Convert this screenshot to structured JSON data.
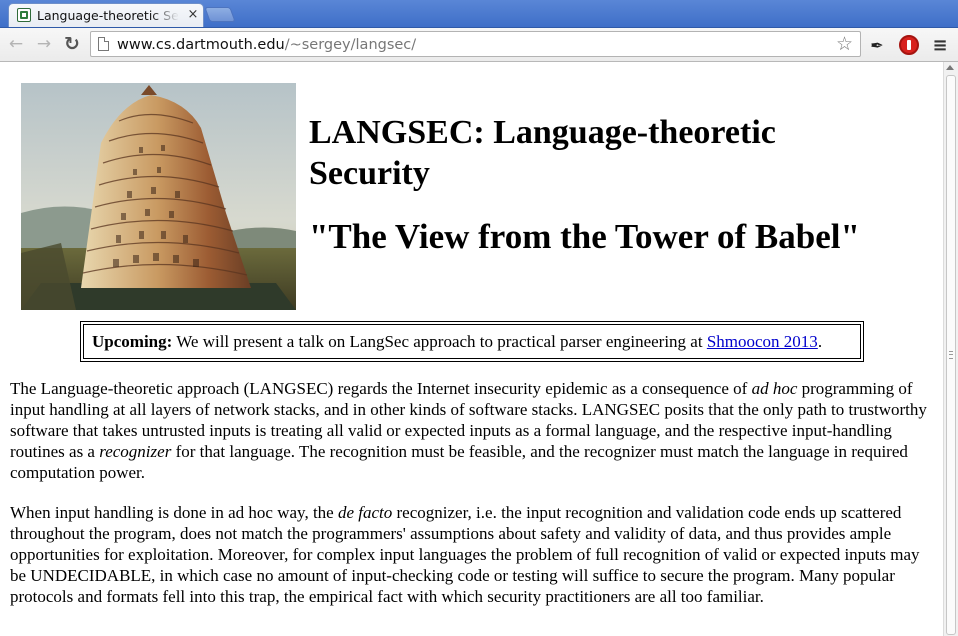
{
  "browser": {
    "tab_title": "Language-theoretic Security",
    "tab_close": "×",
    "url_host": "www.cs.dartmouth.edu",
    "url_path": "/~sergey/langsec/",
    "icons": {
      "back": "back-arrow-icon",
      "forward": "forward-arrow-icon",
      "reload": "reload-icon",
      "star": "bookmark-star-icon",
      "extension_1": "pin-icon",
      "extension_2": "stop-sign-icon",
      "menu": "hamburger-menu-icon"
    }
  },
  "page": {
    "image_subject": "Tower of Babel painting",
    "title_line1": "LANGSEC: Language-theoretic",
    "title_line2": "Security",
    "subtitle": "\"The View from the Tower of Babel\"",
    "upcoming": {
      "label": "Upcoming:",
      "text": " We will present a talk on LangSec approach to practical parser engineering at ",
      "link_text": "Shmoocon 2013",
      "after": "."
    },
    "paragraph1": {
      "part1": "The Language-theoretic approach (LANGSEC) regards the Internet insecurity epidemic as a consequence of ",
      "em1": "ad hoc",
      "part2": " programming of input handling at all layers of network stacks, and in other kinds of software stacks. LANGSEC posits that the only path to trustworthy software that takes untrusted inputs is treating all valid or expected inputs as a formal language, and the respective input-handling routines as a ",
      "em2": "recognizer",
      "part3": " for that language. The recognition must be feasible, and the recognizer must match the language in required computation power."
    },
    "paragraph2": {
      "part1": "When input handling is done in ad hoc way, the ",
      "em1": "de facto",
      "part2": " recognizer, i.e. the input recognition and validation code ends up scattered throughout the program, does not match the programmers' assumptions about safety and validity of data, and thus provides ample opportunities for exploitation. Moreover, for complex input languages the problem of full recognition of valid or expected inputs may be UNDECIDABLE, in which case no amount of input-checking code or testing will suffice to secure the program. Many popular protocols and formats fell into this trap, the empirical fact with which security practitioners are all too familiar."
    }
  },
  "colors": {
    "link": "#0000cc",
    "tabstrip": "#4a7bd0",
    "text": "#000000"
  }
}
